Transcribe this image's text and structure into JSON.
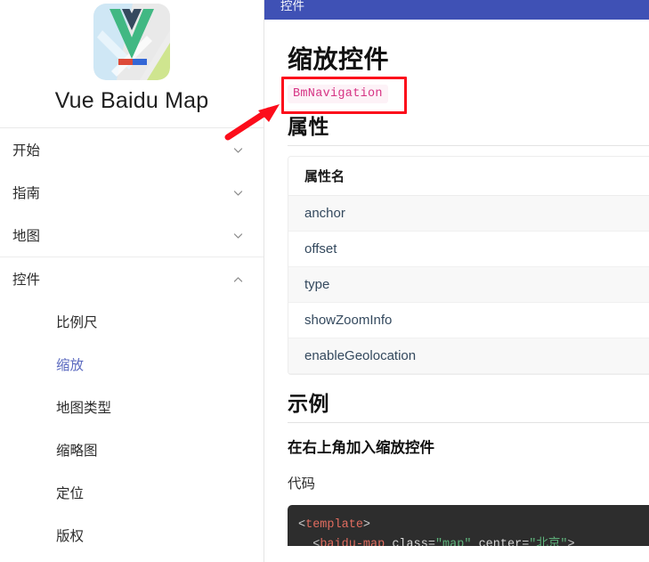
{
  "brand": {
    "logo_icon": "vue-baidu-map-logo",
    "title": "Vue Baidu Map"
  },
  "sidebar": {
    "groups": [
      {
        "label": "开始",
        "icon": "chevron-down-icon",
        "expanded": false
      },
      {
        "label": "指南",
        "icon": "chevron-down-icon",
        "expanded": false
      },
      {
        "label": "地图",
        "icon": "chevron-down-icon",
        "expanded": false
      },
      {
        "label": "控件",
        "icon": "chevron-up-icon",
        "expanded": true
      }
    ],
    "sub_items": [
      {
        "label": "比例尺",
        "active": false
      },
      {
        "label": "缩放",
        "active": true
      },
      {
        "label": "地图类型",
        "active": false
      },
      {
        "label": "缩略图",
        "active": false
      },
      {
        "label": "定位",
        "active": false
      },
      {
        "label": "版权",
        "active": false
      }
    ]
  },
  "topbar": {
    "title": "控件",
    "background": "#3f51b5"
  },
  "main": {
    "page_title": "缩放控件",
    "component_chip": "BmNavigation",
    "attributes_heading": "属性",
    "table": {
      "columns": [
        "属性名"
      ],
      "rows": [
        [
          "anchor"
        ],
        [
          "offset"
        ],
        [
          "type"
        ],
        [
          "showZoomInfo"
        ],
        [
          "enableGeolocation"
        ]
      ]
    },
    "example_heading": "示例",
    "example_subheading": "在右上角加入缩放控件",
    "code_heading": "代码",
    "code_lines": [
      [
        {
          "t": "<",
          "c": "punc"
        },
        {
          "t": "template",
          "c": "tag"
        },
        {
          "t": ">",
          "c": "punc"
        }
      ],
      [
        {
          "t": "  <",
          "c": "punc"
        },
        {
          "t": "baidu-map",
          "c": "tag"
        },
        {
          "t": " class",
          "c": "attr"
        },
        {
          "t": "=",
          "c": "punc"
        },
        {
          "t": "\"map\"",
          "c": "str"
        },
        {
          "t": " center",
          "c": "attr"
        },
        {
          "t": "=",
          "c": "punc"
        },
        {
          "t": "\"北京\"",
          "c": "str"
        },
        {
          "t": ">",
          "c": "punc"
        }
      ]
    ]
  },
  "annotations": {
    "highlight_color": "#fc0d1b",
    "box_target": "component-chip",
    "arrow_target": "component-chip"
  },
  "colors": {
    "accent": "#3f51b5",
    "active_link": "#5c6bc0",
    "chip_bg": "#fdf2f7",
    "chip_text": "#d63384",
    "code_bg": "#2d2d2d"
  }
}
